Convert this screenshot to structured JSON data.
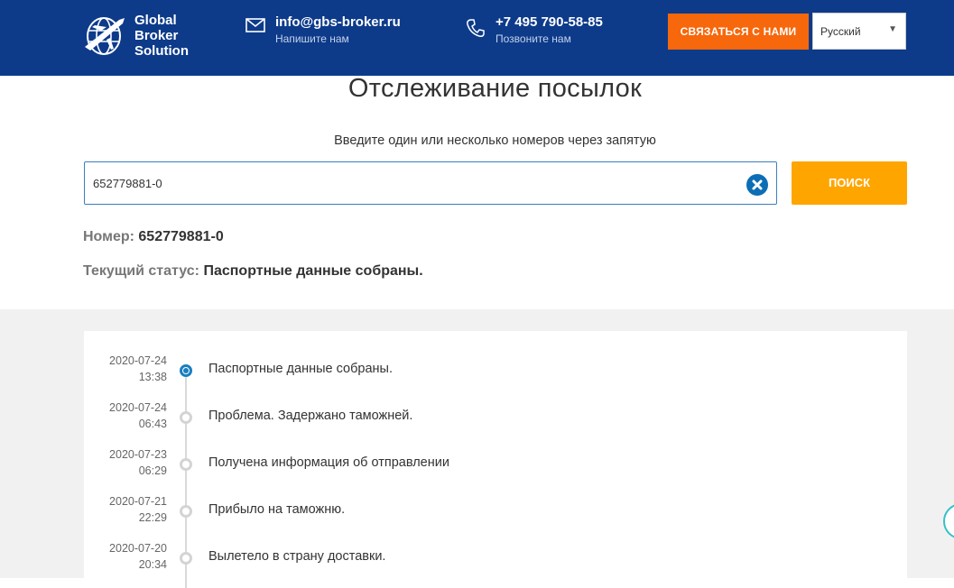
{
  "header": {
    "logo_lines": [
      "Global",
      "Broker",
      "Solution"
    ],
    "email": "info@gbs-broker.ru",
    "email_sub": "Напишите нам",
    "phone": "+7 495 790-58-85",
    "phone_sub": "Позвоните нам",
    "contact_button": "СВЯЗАТЬСЯ С НАМИ",
    "language": "Русский",
    "brand_color": "#0d3b8a",
    "accent_color": "#f7670b"
  },
  "tracking": {
    "title": "Отслеживание посылок",
    "hint": "Введите один или несколько номеров через запятую",
    "input_value": "652779881-0",
    "search_button": "ПОИСК",
    "number_label": "Номер:",
    "number_value": "652779881-0",
    "status_label": "Текущий статус:",
    "status_value": "Паспортные данные собраны."
  },
  "timeline": [
    {
      "date": "2020-07-24",
      "time": "13:38",
      "text": "Паспортные данные собраны.",
      "active": true
    },
    {
      "date": "2020-07-24",
      "time": "06:43",
      "text": "Проблема. Задержано таможней.",
      "active": false
    },
    {
      "date": "2020-07-23",
      "time": "06:29",
      "text": "Получена информация об отправлении",
      "active": false
    },
    {
      "date": "2020-07-21",
      "time": "22:29",
      "text": "Прибыло на таможню.",
      "active": false
    },
    {
      "date": "2020-07-20",
      "time": "20:34",
      "text": "Вылетело в страну доставки.",
      "active": false
    }
  ],
  "icons": {
    "logo": "globe-airplane-icon",
    "email": "envelope-icon",
    "phone": "phone-icon",
    "clear": "clear-x-icon",
    "language_arrow": "chevron-down-icon"
  }
}
